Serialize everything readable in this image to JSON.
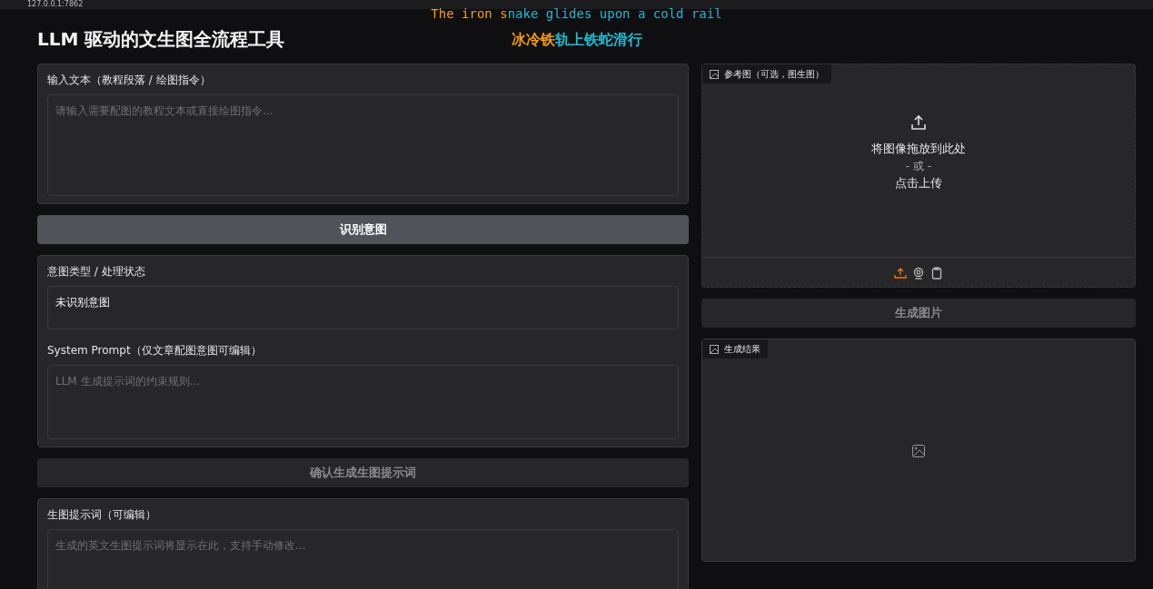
{
  "browser": {
    "url": "127.0.0.1:7862"
  },
  "lyrics": [
    {
      "kind": "mono",
      "segments": [
        {
          "text": "The iron s",
          "color": "#f59e0b"
        },
        {
          "text": "nake glides upon a cold rail",
          "color": "#22b8cf"
        }
      ]
    },
    {
      "kind": "sans",
      "segments": [
        {
          "text": "冰冷铁",
          "color": "#f59e0b"
        },
        {
          "text": "轨上铁蛇滑行",
          "color": "#22b8cf"
        }
      ]
    }
  ],
  "title": "LLM 驱动的文生图全流程工具",
  "input_panel": {
    "label": "输入文本（教程段落 / 绘图指令）",
    "placeholder": "请输入需要配图的教程文本或直接绘图指令..."
  },
  "detect_button": {
    "label": "识别意图",
    "disabled": false
  },
  "intent_panel": {
    "label": "意图类型 / 处理状态",
    "value": "未识别意图",
    "prompt_label": "System Prompt（仅文章配图意图可编辑）",
    "prompt_placeholder": "LLM 生成提示词的约束规则..."
  },
  "confirm_button": {
    "label": "确认生成生图提示词",
    "disabled": true
  },
  "prompt_panel": {
    "label": "生图提示词（可编辑）",
    "placeholder": "生成的英文生图提示词将显示在此，支持手动修改..."
  },
  "reference_image": {
    "label": "参考图（可选，图生图）",
    "drop_text": "将图像拖放到此处",
    "or_text": "- 或 -",
    "click_text": "点击上传",
    "sources": [
      {
        "kind": "upload",
        "selected": true
      },
      {
        "kind": "webcam",
        "selected": false
      },
      {
        "kind": "clipboard",
        "selected": false
      }
    ]
  },
  "generate_button": {
    "label": "生成图片",
    "disabled": true
  },
  "result": {
    "label": "生成结果"
  }
}
